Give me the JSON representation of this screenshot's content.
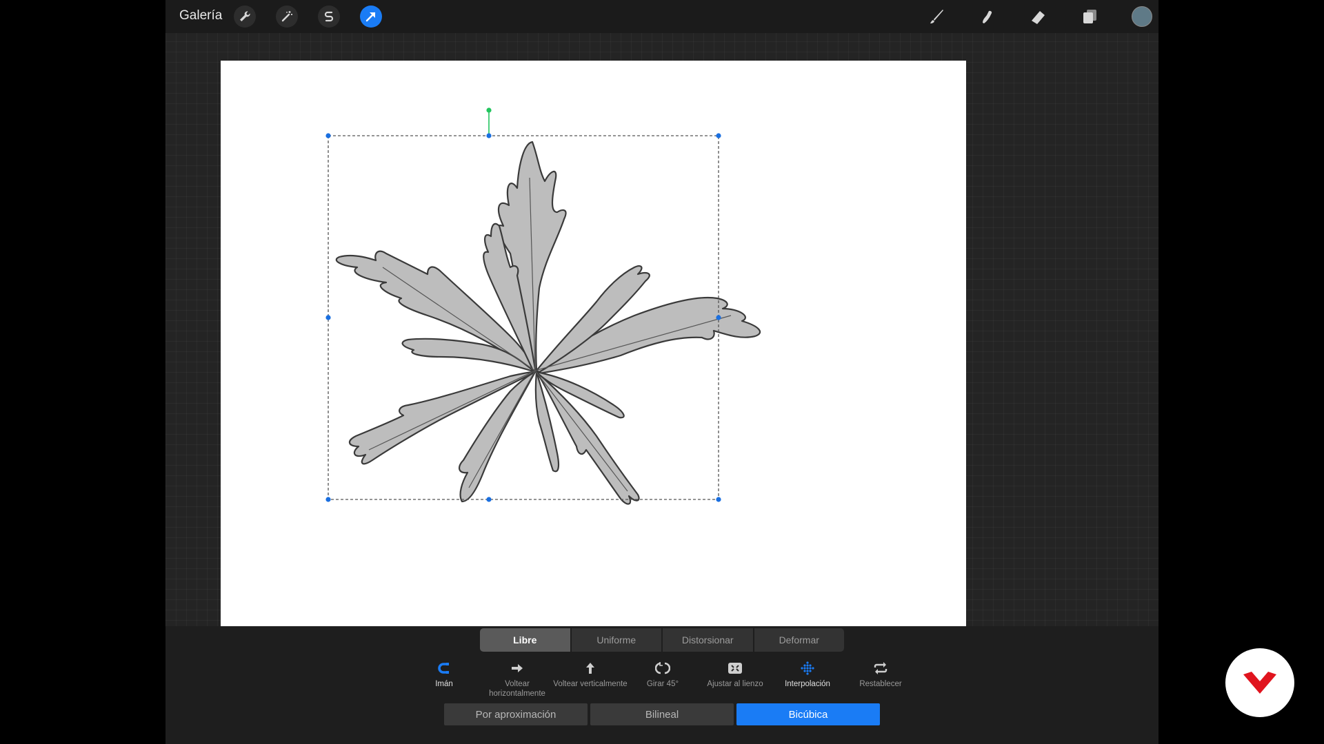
{
  "topbar": {
    "gallery_label": "Galería",
    "left_tools": [
      {
        "icon": "wrench-icon",
        "name": "Acciones"
      },
      {
        "icon": "magic-wand-icon",
        "name": "Ajustes"
      },
      {
        "icon": "selection-s-icon",
        "name": "Selección"
      },
      {
        "icon": "transform-arrow-icon",
        "name": "Transformar",
        "active": true
      }
    ],
    "right_tools": [
      {
        "icon": "brush-icon"
      },
      {
        "icon": "smudge-icon"
      },
      {
        "icon": "eraser-icon"
      },
      {
        "icon": "layers-icon"
      }
    ],
    "current_color": "#5f7a87"
  },
  "transform_modes": {
    "items": [
      "Libre",
      "Uniforme",
      "Distorsionar",
      "Deformar"
    ],
    "selected": "Libre"
  },
  "tools": [
    {
      "label": "Imán",
      "icon": "magnet-icon",
      "active": true
    },
    {
      "label": "Voltear horizontalmente",
      "icon": "arrow-right-icon"
    },
    {
      "label": "Voltear verticalmente",
      "icon": "arrow-up-icon"
    },
    {
      "label": "Girar 45°",
      "icon": "rotate-icon"
    },
    {
      "label": "Ajustar al lienzo",
      "icon": "fit-canvas-icon"
    },
    {
      "label": "Interpolación",
      "icon": "interpolation-grid-icon",
      "active": true
    },
    {
      "label": "Restablecer",
      "icon": "reset-icon"
    }
  ],
  "interpolation": {
    "options": [
      "Por aproximación",
      "Bilineal",
      "Bicúbica"
    ],
    "selected": "Bicúbica"
  },
  "colors": {
    "accent": "#1a7cf5",
    "selection_handle": "#1a6fe0",
    "rotation_handle": "#22c55e",
    "logo_red": "#e0141e"
  }
}
